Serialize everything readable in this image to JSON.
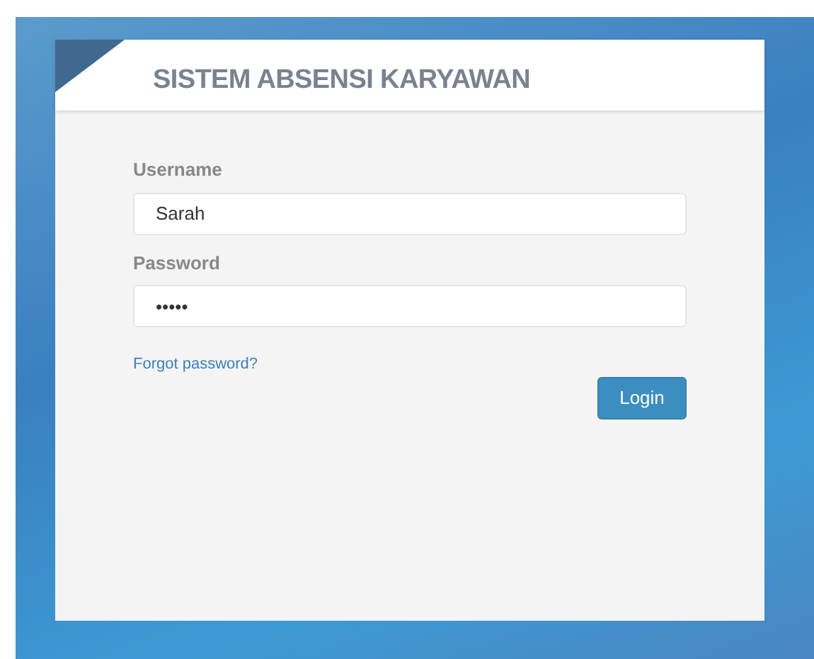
{
  "title": "SISTEM ABSENSI KARYAWAN",
  "fields": [
    {
      "label": "Username",
      "value": "Sarah"
    },
    {
      "label": "Password",
      "value": "•••••"
    }
  ],
  "forgot_link": "Forgot password?",
  "login_button": "Login"
}
